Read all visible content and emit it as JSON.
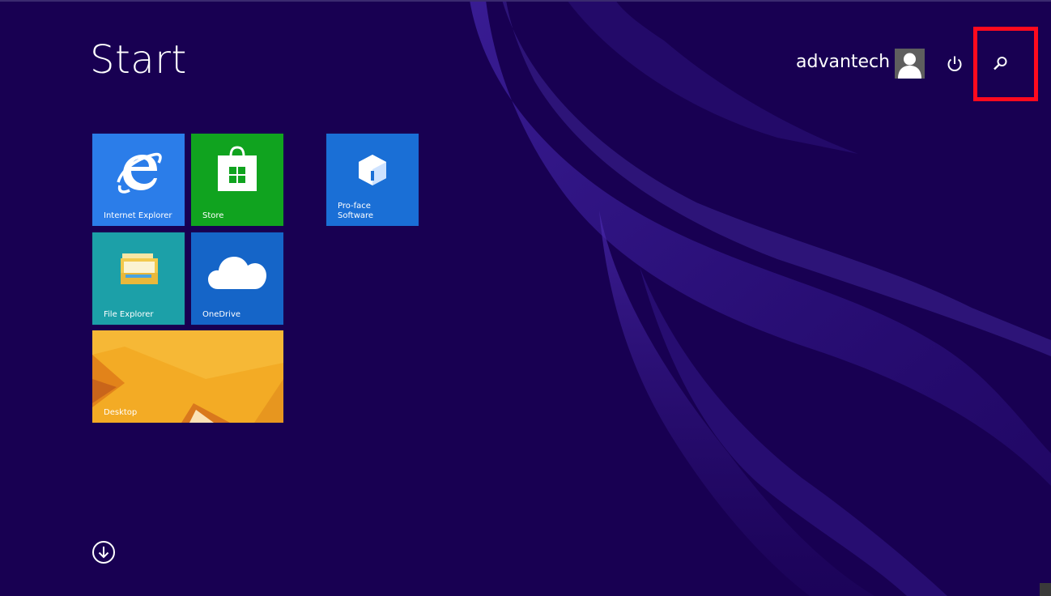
{
  "header": {
    "title": "Start",
    "user_name": "advantech",
    "avatar_icon": "user-avatar-icon",
    "power_icon": "power-icon",
    "search_icon": "search-icon",
    "highlight_color": "#ff0a1e"
  },
  "tiles": [
    {
      "label": "Internet Explorer",
      "icon": "internet-explorer-icon",
      "color": "#2b7de9"
    },
    {
      "label": "Store",
      "icon": "store-icon",
      "color": "#10a31f"
    },
    {
      "label": "Pro-face\nSoftware",
      "icon": "pro-face-software-icon",
      "color": "#1a6fd6"
    },
    {
      "label": "File Explorer",
      "icon": "file-explorer-icon",
      "color": "#1ca0a8"
    },
    {
      "label": "OneDrive",
      "icon": "onedrive-icon",
      "color": "#1565c8"
    },
    {
      "label": "Desktop",
      "icon": "desktop-wallpaper",
      "color": "#f1a824"
    }
  ],
  "footer": {
    "all_apps_icon": "down-arrow-circle-icon"
  },
  "colors": {
    "background": "#180052"
  }
}
